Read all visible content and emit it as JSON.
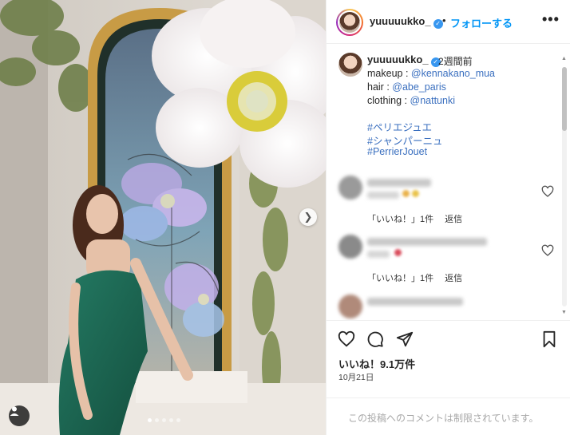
{
  "header": {
    "username": "yuuuuukko_",
    "separator": "•",
    "follow_label": "フォローする",
    "more_label": "•••"
  },
  "caption": {
    "username": "yuuuuukko_",
    "time_ago": "2週間前",
    "lines": [
      {
        "prefix": "makeup : ",
        "handle": "@kennakano_mua"
      },
      {
        "prefix": "hair : ",
        "handle": "@abe_paris"
      },
      {
        "prefix": "clothing : ",
        "handle": "@nattunki"
      }
    ],
    "hashtags": [
      "#ペリエジュエ",
      "#シャンパーニュ",
      "#PerrierJouet"
    ]
  },
  "comments": [
    {
      "like_label": "「いいね！」1件",
      "reply_label": "返信"
    },
    {
      "like_label": "「いいね！」1件",
      "reply_label": "返信"
    }
  ],
  "post": {
    "likes_text": "いいね！9.1万件",
    "date_text": "10月21日",
    "comment_disabled_text": "この投稿へのコメントは制限されています。"
  },
  "carousel": {
    "slide_count": 5,
    "active_index": 0
  },
  "icons": {
    "next": "chevron-right-icon",
    "tagged_user": "user-tag-icon",
    "like": "heart-icon",
    "comment": "comment-icon",
    "share": "share-icon",
    "save": "bookmark-icon"
  },
  "colors": {
    "accent": "#0095f6",
    "link": "#3a6fbf",
    "verified": "#3897f0",
    "dress": "#1e6b57"
  }
}
